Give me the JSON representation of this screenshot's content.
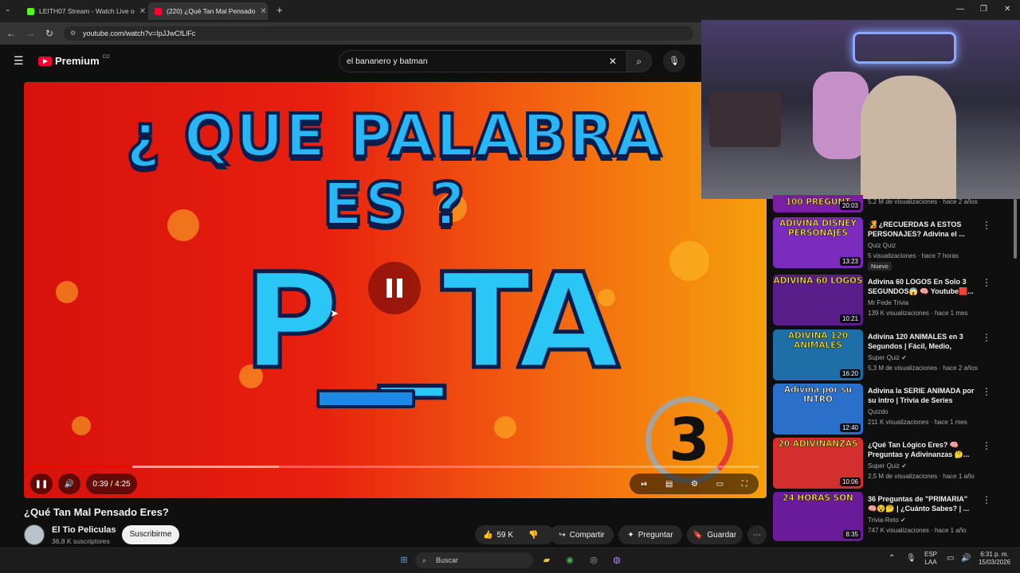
{
  "browser": {
    "tabs": [
      {
        "label": "LEITH07 Stream - Watch Live o",
        "active": false,
        "favicon_color": "#53fc18"
      },
      {
        "label": "(220) ¿Qué Tan Mal Pensado",
        "active": true,
        "favicon_color": "#ff0033"
      }
    ],
    "url": "youtube.com/watch?v=IpJJwCfLlFc"
  },
  "youtube": {
    "logo_text": "Premium",
    "logo_region": "CO",
    "search_value": "el bananero y batman"
  },
  "player": {
    "overlay_title": "¿ QUE PALABRA ES ?",
    "overlay_word": "P _TA",
    "countdown": "3",
    "time": "0:39 / 4:25",
    "progress_fraction": 0.147,
    "buffer_fraction": 0.347
  },
  "video": {
    "title": "¿Qué Tan Mal Pensado Eres?",
    "channel": "El Tio Peliculas",
    "subscribers": "36,8 K suscriptores",
    "subscribe_label": "Suscribirme",
    "likes": "59 K",
    "share_label": "Compartir",
    "ask_label": "Preguntar",
    "save_label": "Guardar"
  },
  "sidebar": {
    "partial_meta": "5,2 M de visualizaciones · hace 2 años",
    "partial_thumb_text": "100 PREGUNT",
    "partial_duration": "20:03",
    "items": [
      {
        "thumb_text": "ADIVINA DISNEY PERSONAJES",
        "title": "🧏 ¿RECUERDAS A ESTOS PERSONAJES? Adivina el ...",
        "channel": "Quiz Quiz",
        "meta": "5 visualizaciones · hace 7 horas",
        "badge": "Nuevo",
        "duration": "13:23",
        "color": "#7b2cbf"
      },
      {
        "thumb_text": "ADIVINA 60 LOGOS",
        "title": "Adivina 60 LOGOS En Solo 3 SEGUNDOS😱 🧠 Youtube🟥...",
        "channel": "Mr Fede Trivia",
        "meta": "139 K visualizaciones · hace 1 mes",
        "badge": "",
        "duration": "10:21",
        "color": "#5a1e8a"
      },
      {
        "thumb_text": "ADIVINA 120 ANIMALES",
        "title": "Adivina 120 ANIMALES en 3 Segundos | Fácil, Medio, Difícil...",
        "channel": "Super Quiz ✔",
        "meta": "5,3 M de visualizaciones · hace 2 años",
        "badge": "",
        "duration": "16:20",
        "color": "#1e6fa8"
      },
      {
        "thumb_text": "Adivina por su INTRO",
        "title": "Adivina la SERIE ANIMADA por su intro | Trivia de Series",
        "channel": "Quizdo",
        "meta": "211 K visualizaciones · hace 1 mes",
        "badge": "",
        "duration": "12:40",
        "color": "#2a6fc9"
      },
      {
        "thumb_text": "20 ADIVINANZAS",
        "title": "¿Qué Tan Lógico Eres? 🧠 Preguntas y Adivinanzas 🤔...",
        "channel": "Super Quiz ✔",
        "meta": "2,5 M de visualizaciones · hace 1 año",
        "badge": "",
        "duration": "10:06",
        "color": "#d32f2f"
      },
      {
        "thumb_text": "24 HORAS SON",
        "title": "36 Preguntas de \"PRIMARIA\" 🧠😵🤔 | ¿Cuánto Sabes? | ...",
        "channel": "Trivia-Reto ✔",
        "meta": "747 K visualizaciones · hace 1 año",
        "badge": "",
        "duration": "8:35",
        "color": "#6a1b9a"
      }
    ]
  },
  "taskbar": {
    "search_placeholder": "Buscar",
    "lang_top": "ESP",
    "lang_bottom": "LAA",
    "time": "6:31 p. m.",
    "date": "15/03/2026"
  }
}
